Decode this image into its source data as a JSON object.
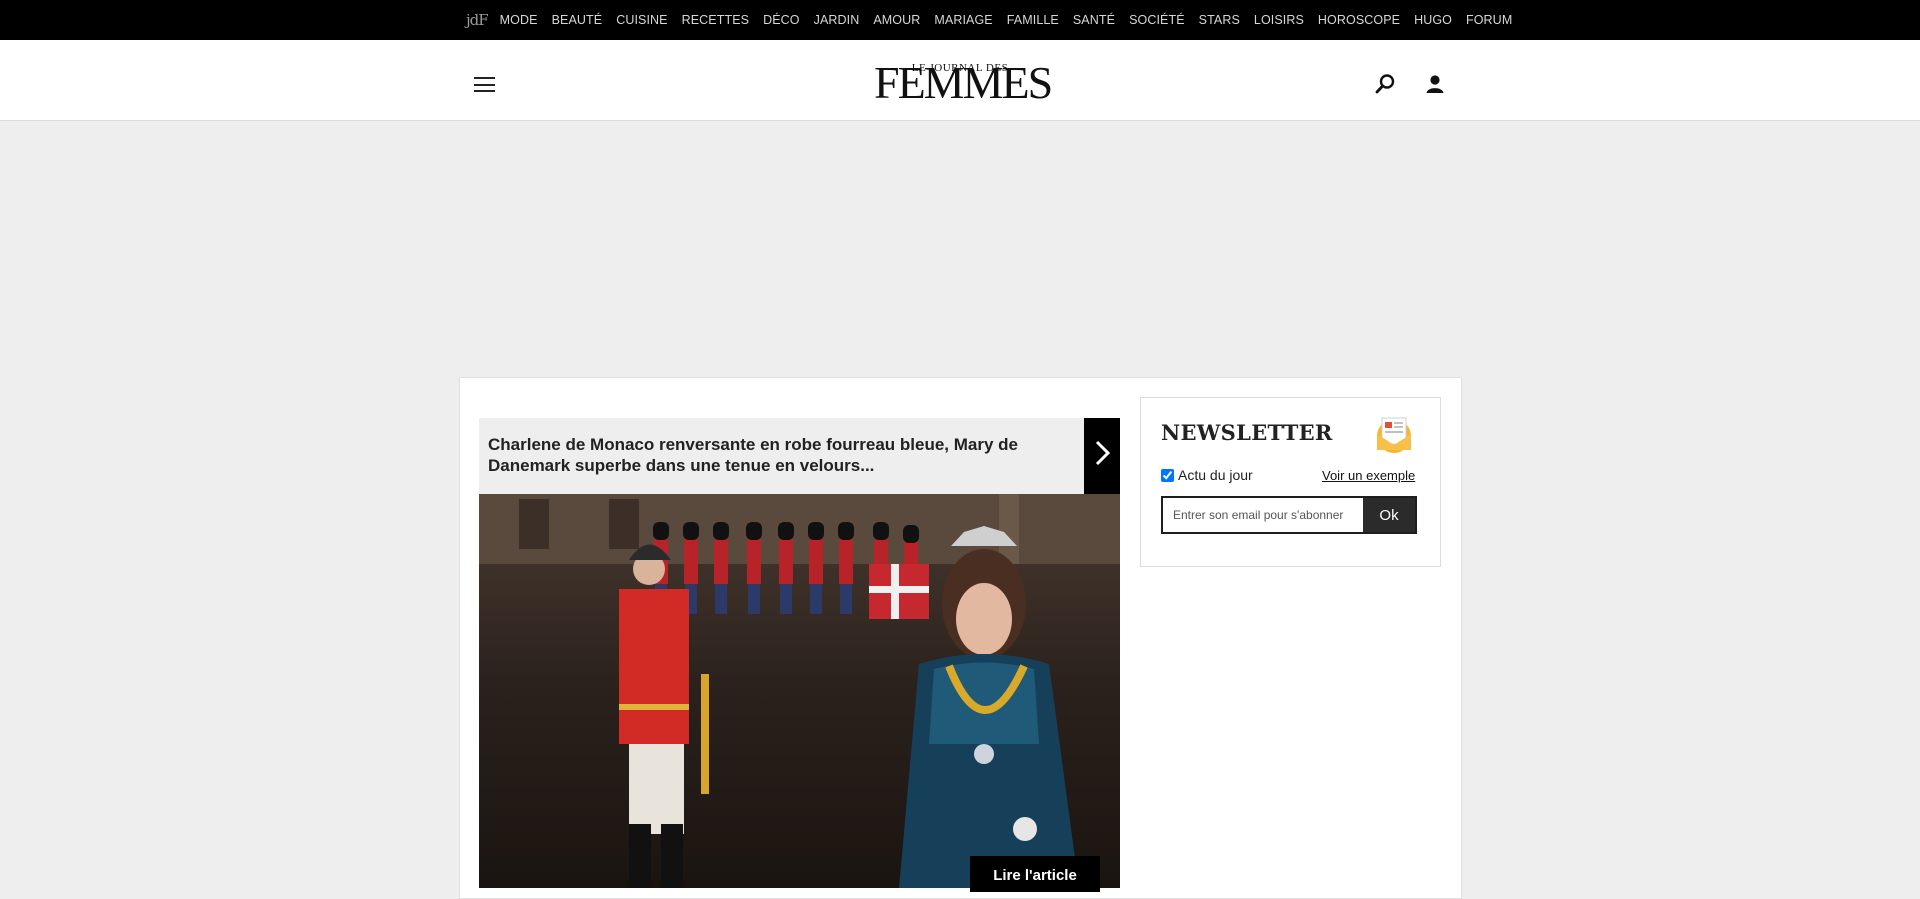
{
  "topnav": {
    "logo": "jdF",
    "items": [
      "MODE",
      "BEAUTÉ",
      "CUISINE",
      "RECETTES",
      "DÉCO",
      "JARDIN",
      "AMOUR",
      "MARIAGE",
      "FAMILLE",
      "SANTÉ",
      "SOCIÉTÉ",
      "STARS",
      "LOISIRS",
      "HOROSCOPE",
      "HUGO",
      "FORUM"
    ]
  },
  "header": {
    "brand_small": "LE JOURNAL DES",
    "brand_big": "FEMMES"
  },
  "article": {
    "headline": "Charlene de Monaco renversante en robe fourreau bleue, Mary de Danemark superbe dans une tenue en velours...",
    "read_label": "Lire l'article"
  },
  "newsletter": {
    "title": "NEWSLETTER",
    "checkbox_label": "Actu du jour",
    "checked": true,
    "example_link": "Voir un exemple",
    "email_placeholder": "Entrer son email pour s'abonner",
    "submit_label": "Ok"
  },
  "colors": {
    "topbar": "#000000",
    "page_bg": "#eeeeee",
    "accent_dark": "#2b2b2b"
  }
}
